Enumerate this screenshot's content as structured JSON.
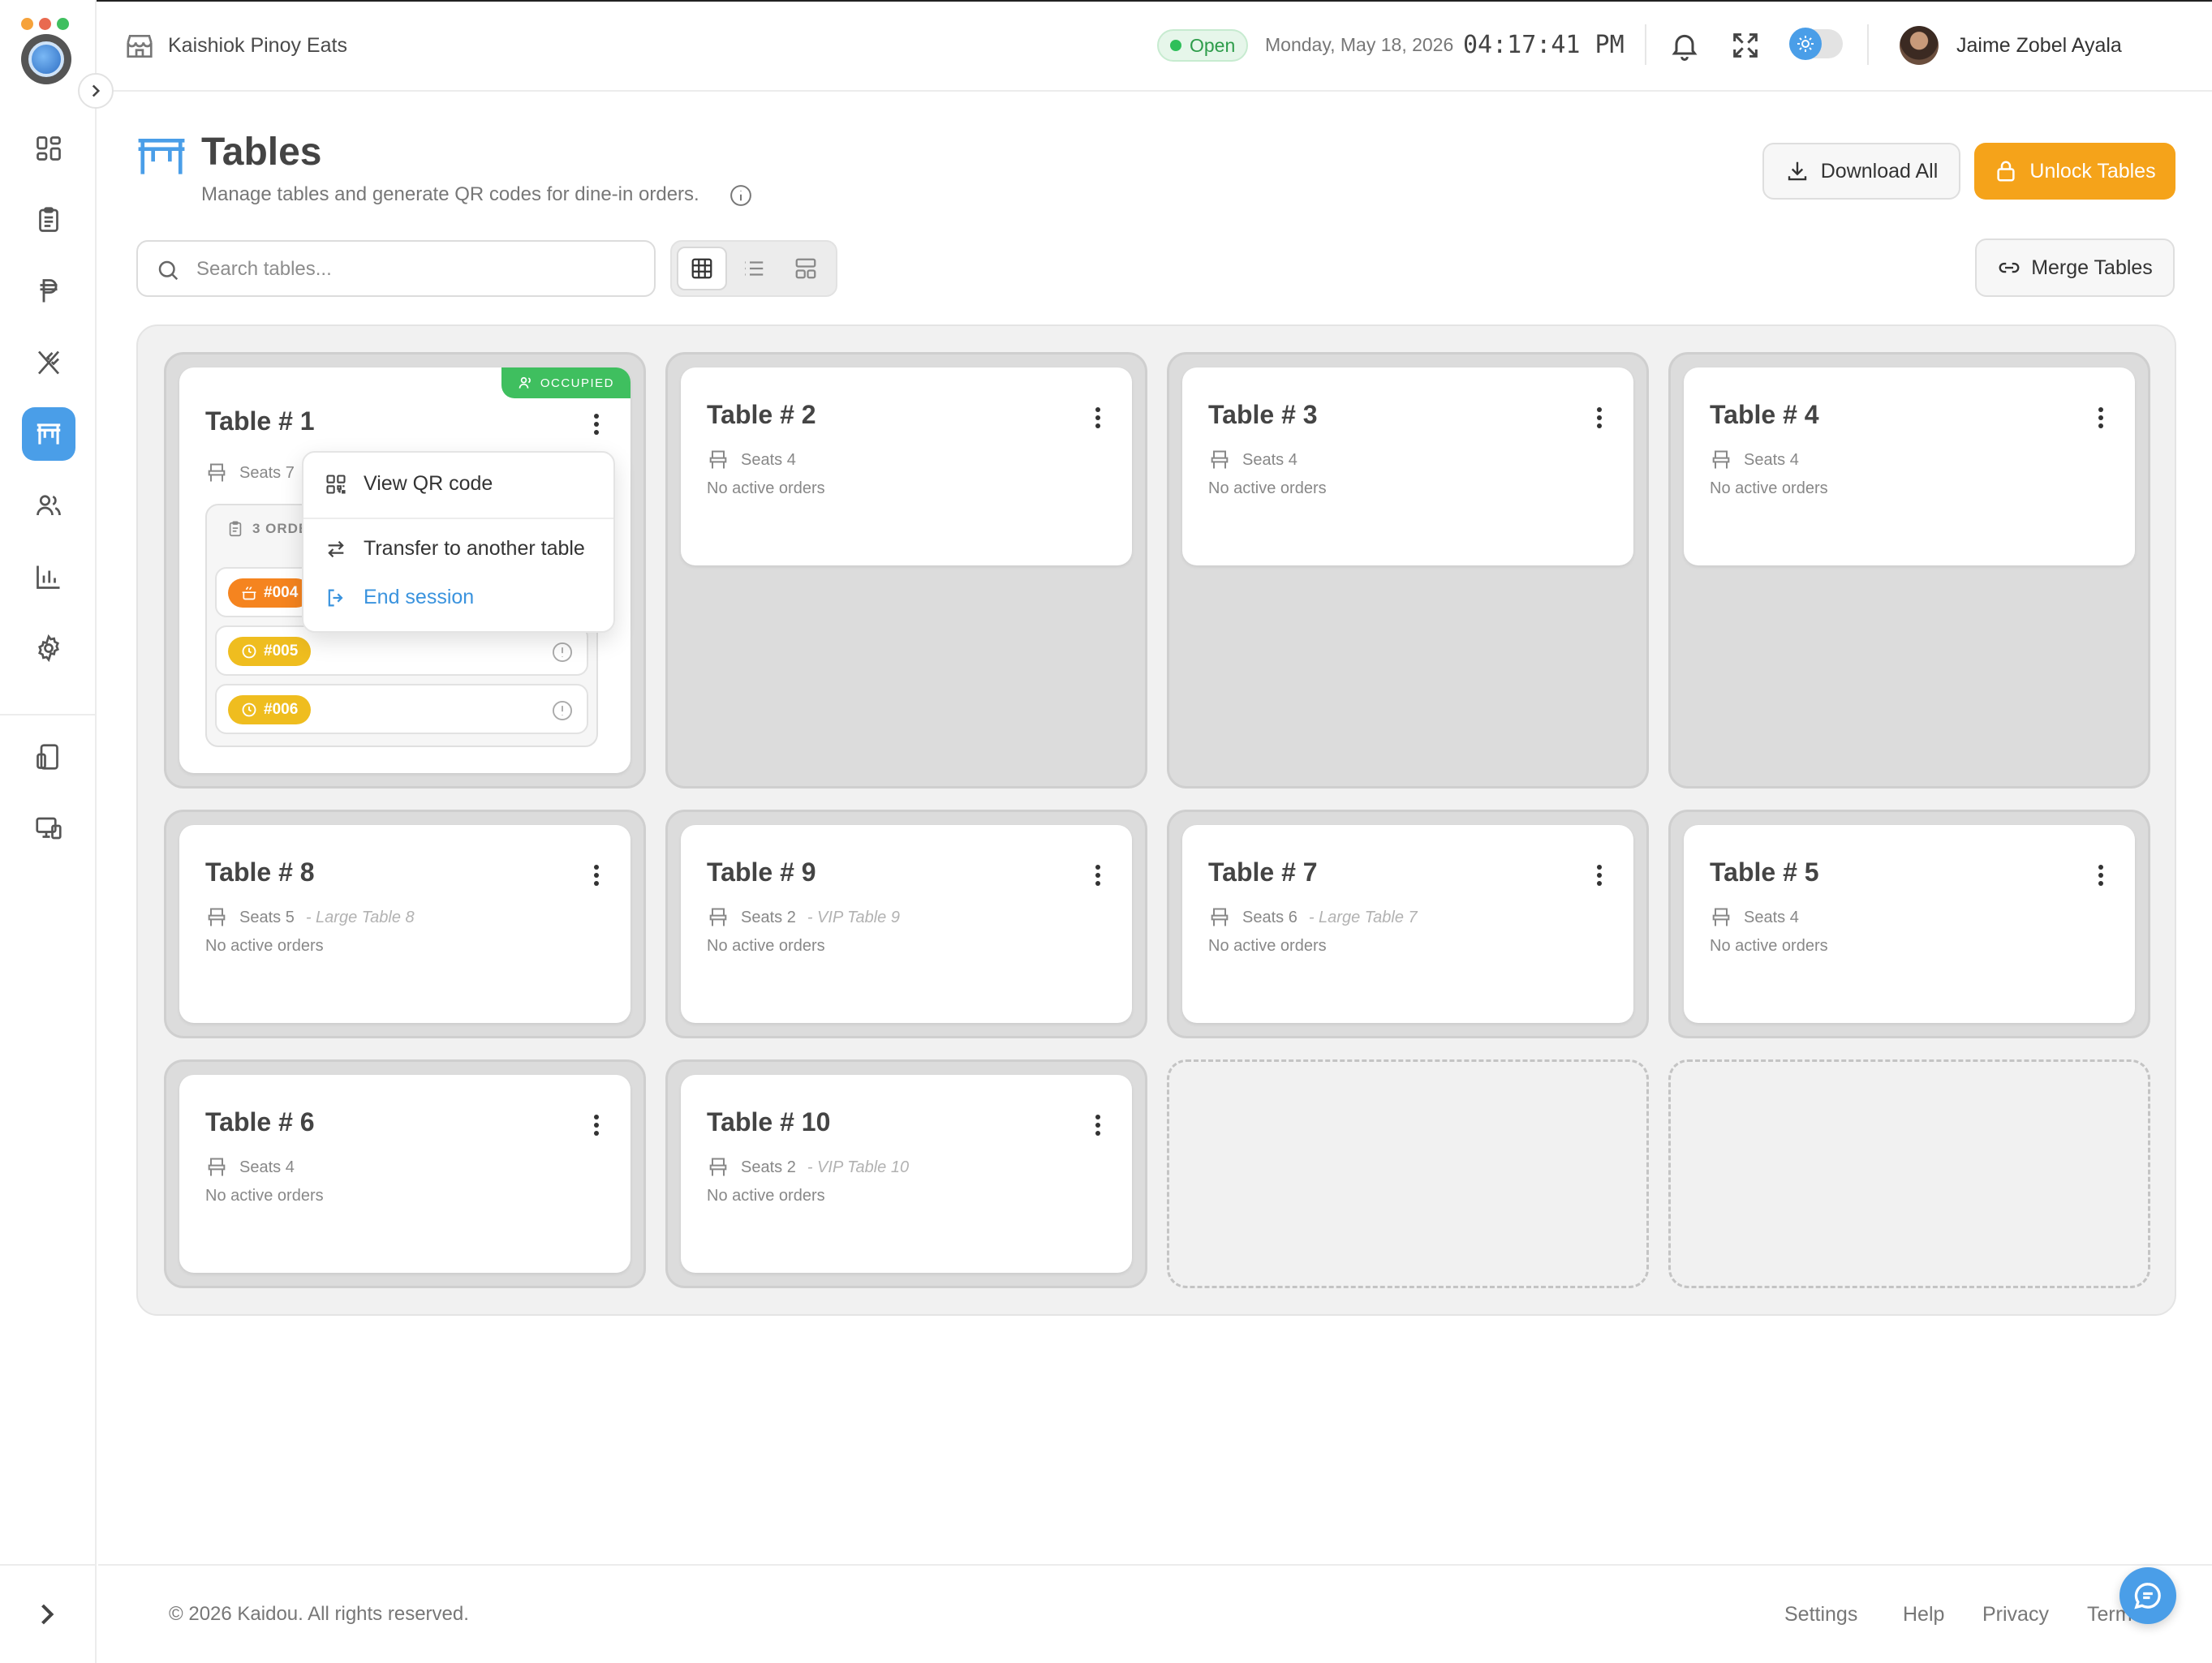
{
  "header": {
    "store_name": "Kaishiok Pinoy Eats",
    "status": "Open",
    "date": "Monday, May 18, 2026",
    "time": "04:17:41 PM",
    "user_name": "Jaime Zobel Ayala"
  },
  "sidebar": {
    "items": [
      {
        "name": "dashboard",
        "icon": "grid-icon"
      },
      {
        "name": "orders",
        "icon": "clipboard-icon"
      },
      {
        "name": "payments",
        "icon": "peso-icon"
      },
      {
        "name": "menu",
        "icon": "utensils-icon"
      },
      {
        "name": "tables",
        "icon": "table-icon",
        "active": true
      },
      {
        "name": "customers",
        "icon": "users-icon"
      },
      {
        "name": "reports",
        "icon": "bar-chart-icon"
      },
      {
        "name": "settings",
        "icon": "gear-icon"
      },
      {
        "name": "kiosk",
        "icon": "tablet-icon"
      },
      {
        "name": "devices",
        "icon": "monitor-icon"
      }
    ]
  },
  "page": {
    "title": "Tables",
    "subtitle": "Manage tables and generate QR codes for dine-in orders.",
    "download_all_label": "Download All",
    "unlock_tables_label": "Unlock Tables",
    "merge_tables_label": "Merge Tables",
    "search_placeholder": "Search tables...",
    "search_value": ""
  },
  "tables": [
    {
      "title": "Table # 1",
      "seats": "Seats 7",
      "note": "",
      "status": "OCCUPIED",
      "orders_count": "3 ORDERS"
    },
    {
      "title": "Table # 2",
      "seats": "Seats 4",
      "note": "",
      "orders": "No active orders"
    },
    {
      "title": "Table # 3",
      "seats": "Seats 4",
      "note": "",
      "orders": "No active orders"
    },
    {
      "title": "Table # 4",
      "seats": "Seats 4",
      "note": "",
      "orders": "No active orders"
    },
    {
      "title": "Table # 8",
      "seats": "Seats 5",
      "note": "- Large Table 8",
      "orders": "No active orders"
    },
    {
      "title": "Table # 9",
      "seats": "Seats 2",
      "note": "- VIP Table 9",
      "orders": "No active orders"
    },
    {
      "title": "Table # 7",
      "seats": "Seats 6",
      "note": "- Large Table 7",
      "orders": "No active orders"
    },
    {
      "title": "Table # 5",
      "seats": "Seats 4",
      "note": "",
      "orders": "No active orders"
    },
    {
      "title": "Table # 6",
      "seats": "Seats 4",
      "note": "",
      "orders": "No active orders"
    },
    {
      "title": "Table # 10",
      "seats": "Seats 2",
      "note": "- VIP Table 10",
      "orders": "No active orders"
    }
  ],
  "table1_orders": [
    {
      "id": "#004",
      "status_color": "#f5841f"
    },
    {
      "id": "#005",
      "status_color": "#efbd1f"
    },
    {
      "id": "#006",
      "status_color": "#efbd1f"
    }
  ],
  "context_menu": {
    "view_qr": "View QR code",
    "transfer": "Transfer to another table",
    "end_session": "End session"
  },
  "footer": {
    "copyright": "© 2026 Kaidou. All rights reserved.",
    "links": [
      "Settings",
      "Help",
      "Privacy",
      "Terms"
    ]
  },
  "colors": {
    "accent": "#4a9ee8",
    "warning": "#f5a31a",
    "success": "#3fbf5f"
  }
}
